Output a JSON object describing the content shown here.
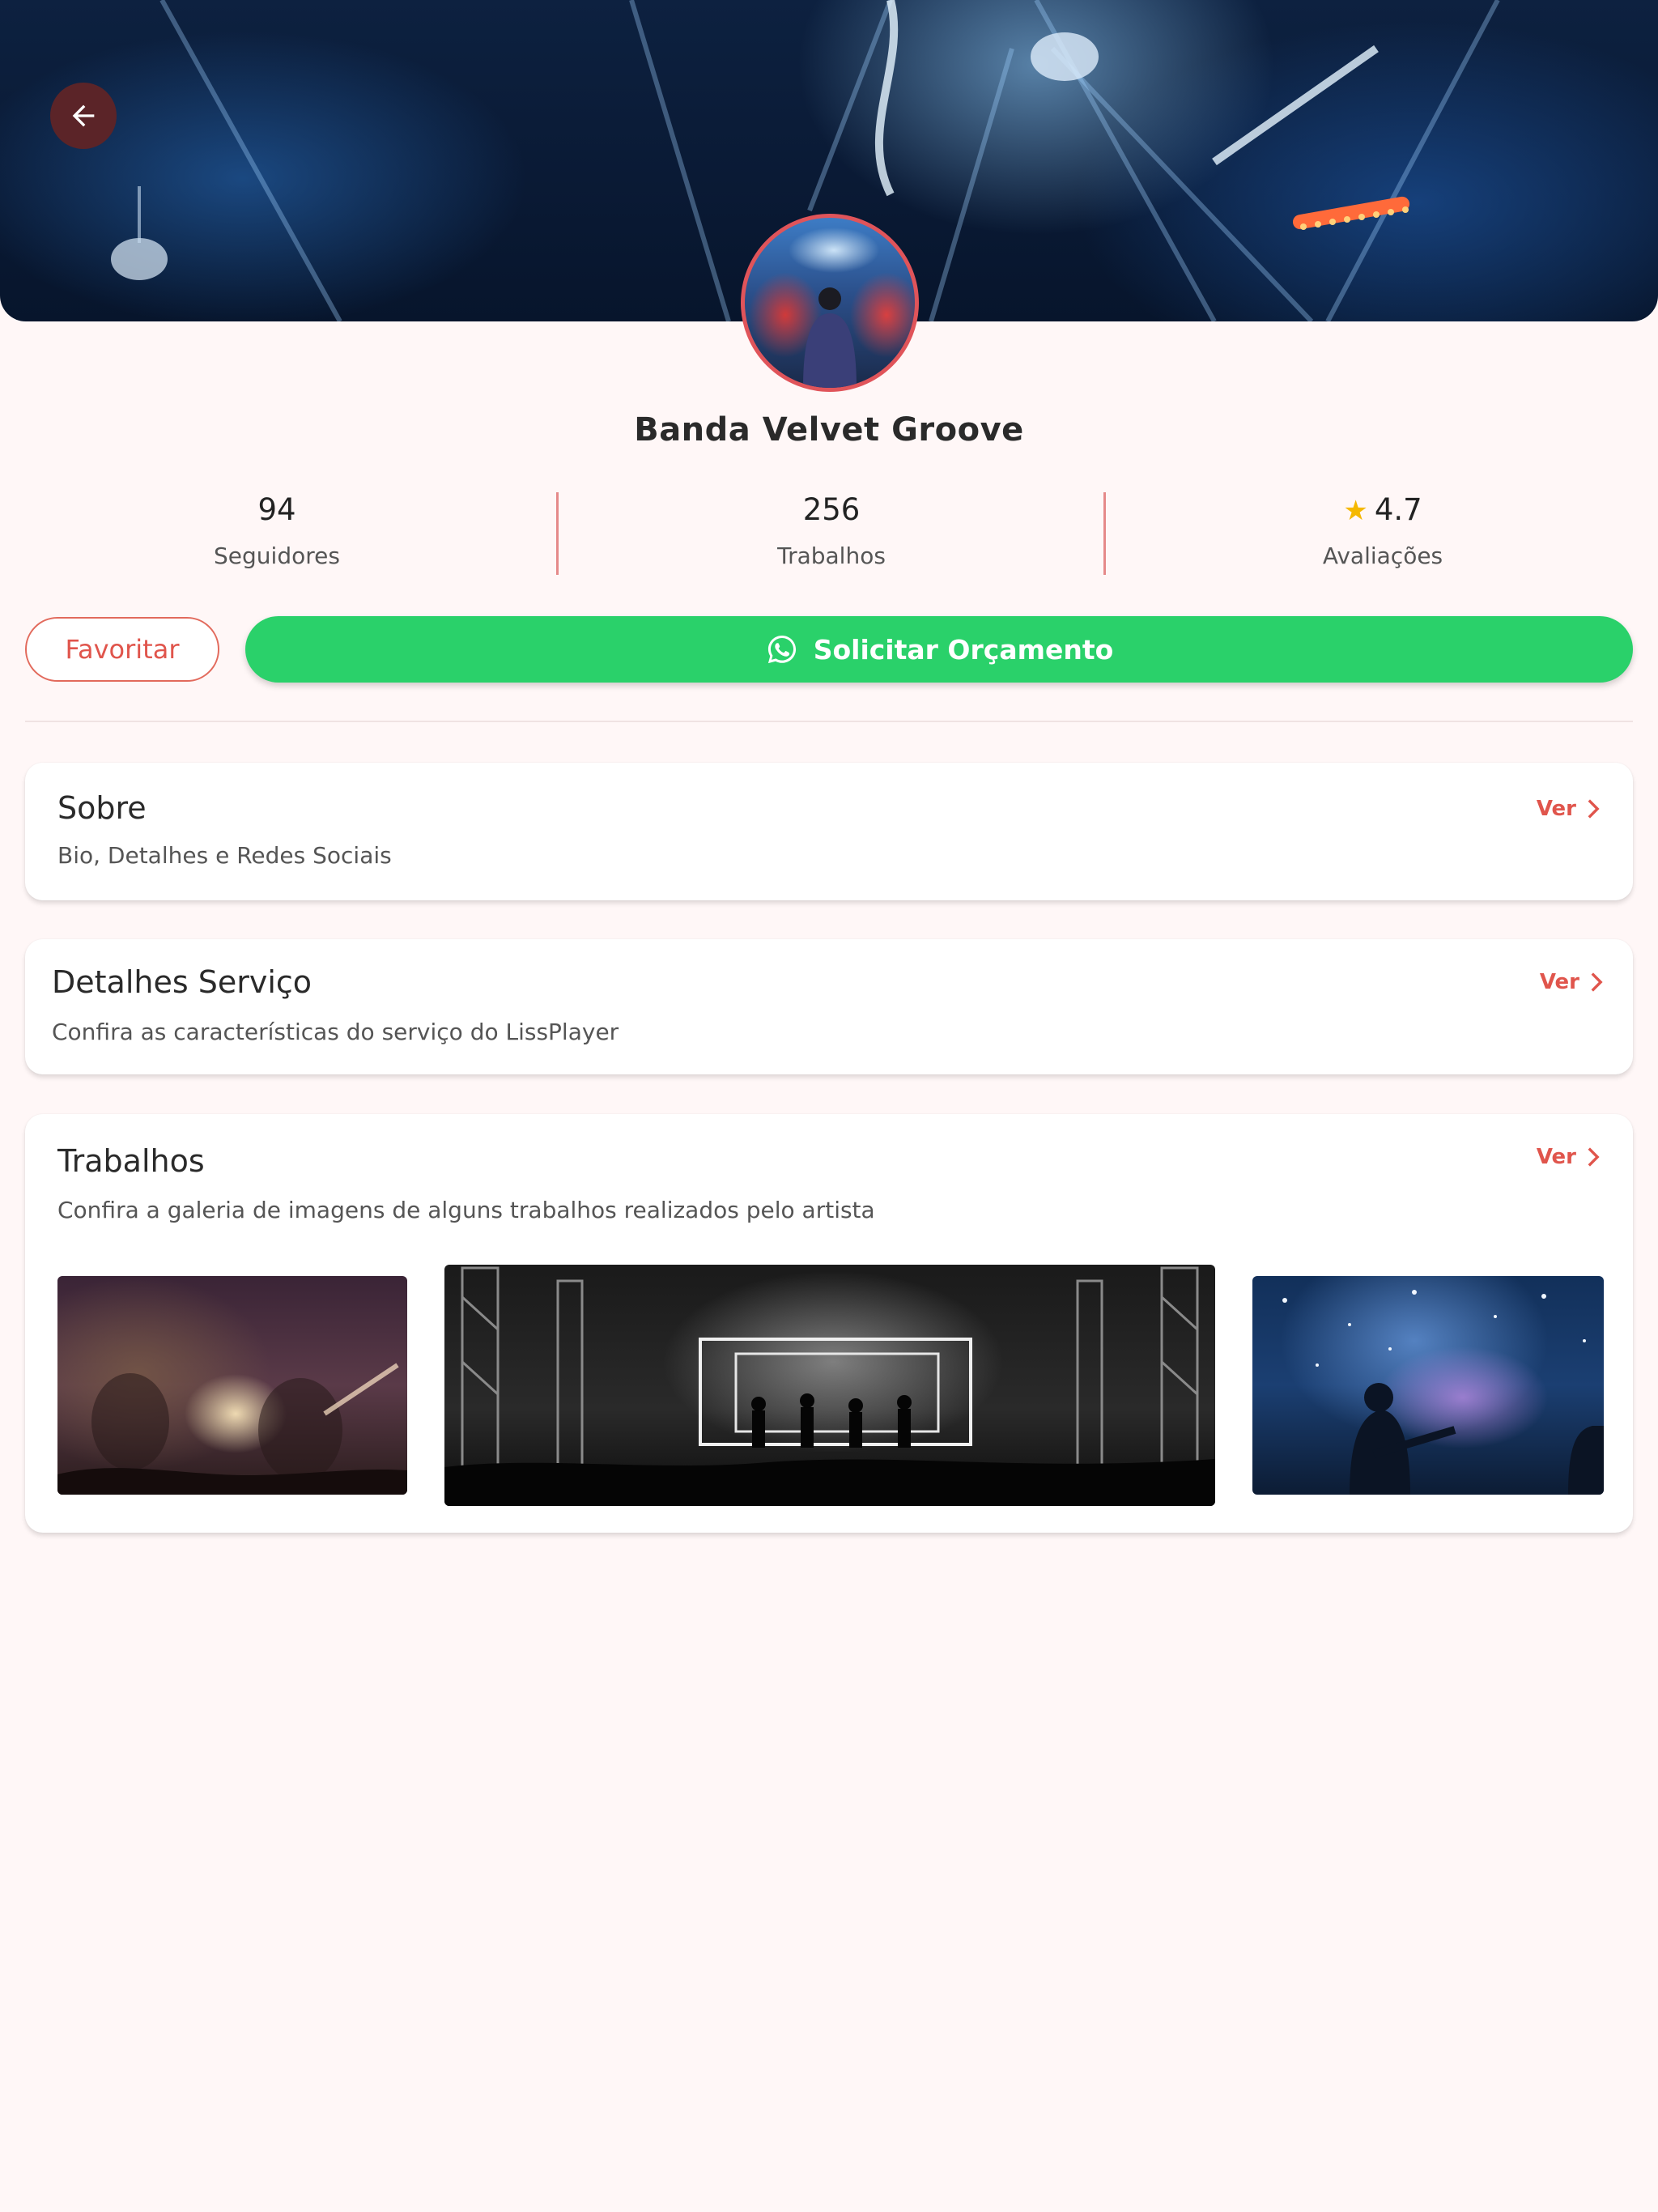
{
  "header": {
    "back_label": "Voltar"
  },
  "profile": {
    "name": "Banda Velvet Groove"
  },
  "stats": [
    {
      "value": "94",
      "label": "Seguidores"
    },
    {
      "value": "256",
      "label": "Trabalhos"
    },
    {
      "value": "4.7",
      "label": "Avaliações",
      "icon": "star-icon"
    }
  ],
  "actions": {
    "favorite_label": "Favoritar",
    "quote_label": "Solicitar Orçamento",
    "quote_icon": "whatsapp-icon"
  },
  "sections": [
    {
      "title": "Sobre",
      "subtitle": "Bio, Detalhes e Redes Sociais",
      "link": "Ver"
    },
    {
      "title": "Detalhes Serviço",
      "subtitle": "Confira as características do serviço do LissPlayer",
      "link": "Ver"
    },
    {
      "title": "Trabalhos",
      "subtitle": "Confira a galeria de imagens de alguns trabalhos realizados pelo artista",
      "link": "Ver"
    }
  ],
  "colors": {
    "accent": "#e0554c",
    "whatsapp_green": "#2ad16a",
    "background": "#fff7f7",
    "star": "#f5b800"
  }
}
